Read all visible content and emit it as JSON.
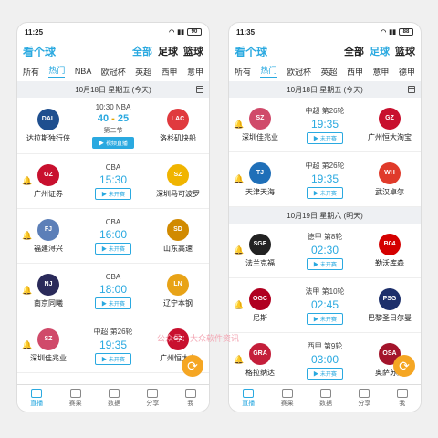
{
  "left": {
    "status_time": "11:25",
    "battery": "90",
    "app_title": "看个球",
    "sports": [
      "全部",
      "足球",
      "篮球"
    ],
    "leagues": [
      "所有",
      "热门",
      "NBA",
      "欧冠杯",
      "英超",
      "西甲",
      "意甲"
    ],
    "date": "10月18日 星期五 (今天)",
    "matches": [
      {
        "league": "10:30 NBA",
        "home": "达拉斯独行侠",
        "away": "洛杉矶快船",
        "score_home": "40",
        "score_sep": "-",
        "score_away": "25",
        "status": "第二节",
        "button": "▶ 视频直播"
      },
      {
        "league": "CBA",
        "home": "广州证券",
        "away": "深圳马可波罗",
        "time": "15:30",
        "button": "▶ 未开赛"
      },
      {
        "league": "CBA",
        "home": "福建浔兴",
        "away": "山东高速",
        "time": "16:00",
        "button": "▶ 未开赛"
      },
      {
        "league": "CBA",
        "home": "南京同曦",
        "away": "辽宁本钢",
        "time": "18:00",
        "button": "▶ 未开赛"
      },
      {
        "league": "中超 第26轮",
        "home": "深圳佳兆业",
        "away": "广州恒大大",
        "time": "19:35",
        "button": "▶ 未开赛"
      }
    ]
  },
  "right": {
    "status_time": "11:35",
    "battery": "88",
    "app_title": "看个球",
    "sports": [
      "全部",
      "足球",
      "篮球"
    ],
    "leagues": [
      "所有",
      "热门",
      "欧冠杯",
      "英超",
      "西甲",
      "意甲",
      "德甲"
    ],
    "date1": "10月18日 星期五 (今天)",
    "date2": "10月19日 星期六 (明天)",
    "matches1": [
      {
        "league": "中超 第26轮",
        "home": "深圳佳兆业",
        "away": "广州恒大淘宝",
        "time": "19:35",
        "button": "▶ 未开赛"
      },
      {
        "league": "中超 第26轮",
        "home": "天津天海",
        "away": "武汉卓尔",
        "time": "19:35",
        "button": "▶ 未开赛"
      }
    ],
    "matches2": [
      {
        "league": "德甲 第8轮",
        "home": "法兰克福",
        "away": "勒沃库森",
        "time": "02:30",
        "button": "▶ 未开赛"
      },
      {
        "league": "法甲 第10轮",
        "home": "尼斯",
        "away": "巴黎圣日尔曼",
        "time": "02:45",
        "button": "▶ 未开赛"
      },
      {
        "league": "西甲 第9轮",
        "home": "格拉纳达",
        "away": "奥萨苏纳",
        "time": "03:00",
        "button": "▶ 未开赛"
      }
    ]
  },
  "tabs": [
    "直播",
    "赛果",
    "数据",
    "分享",
    "我"
  ],
  "watermark": "公众号：大众软件资讯"
}
